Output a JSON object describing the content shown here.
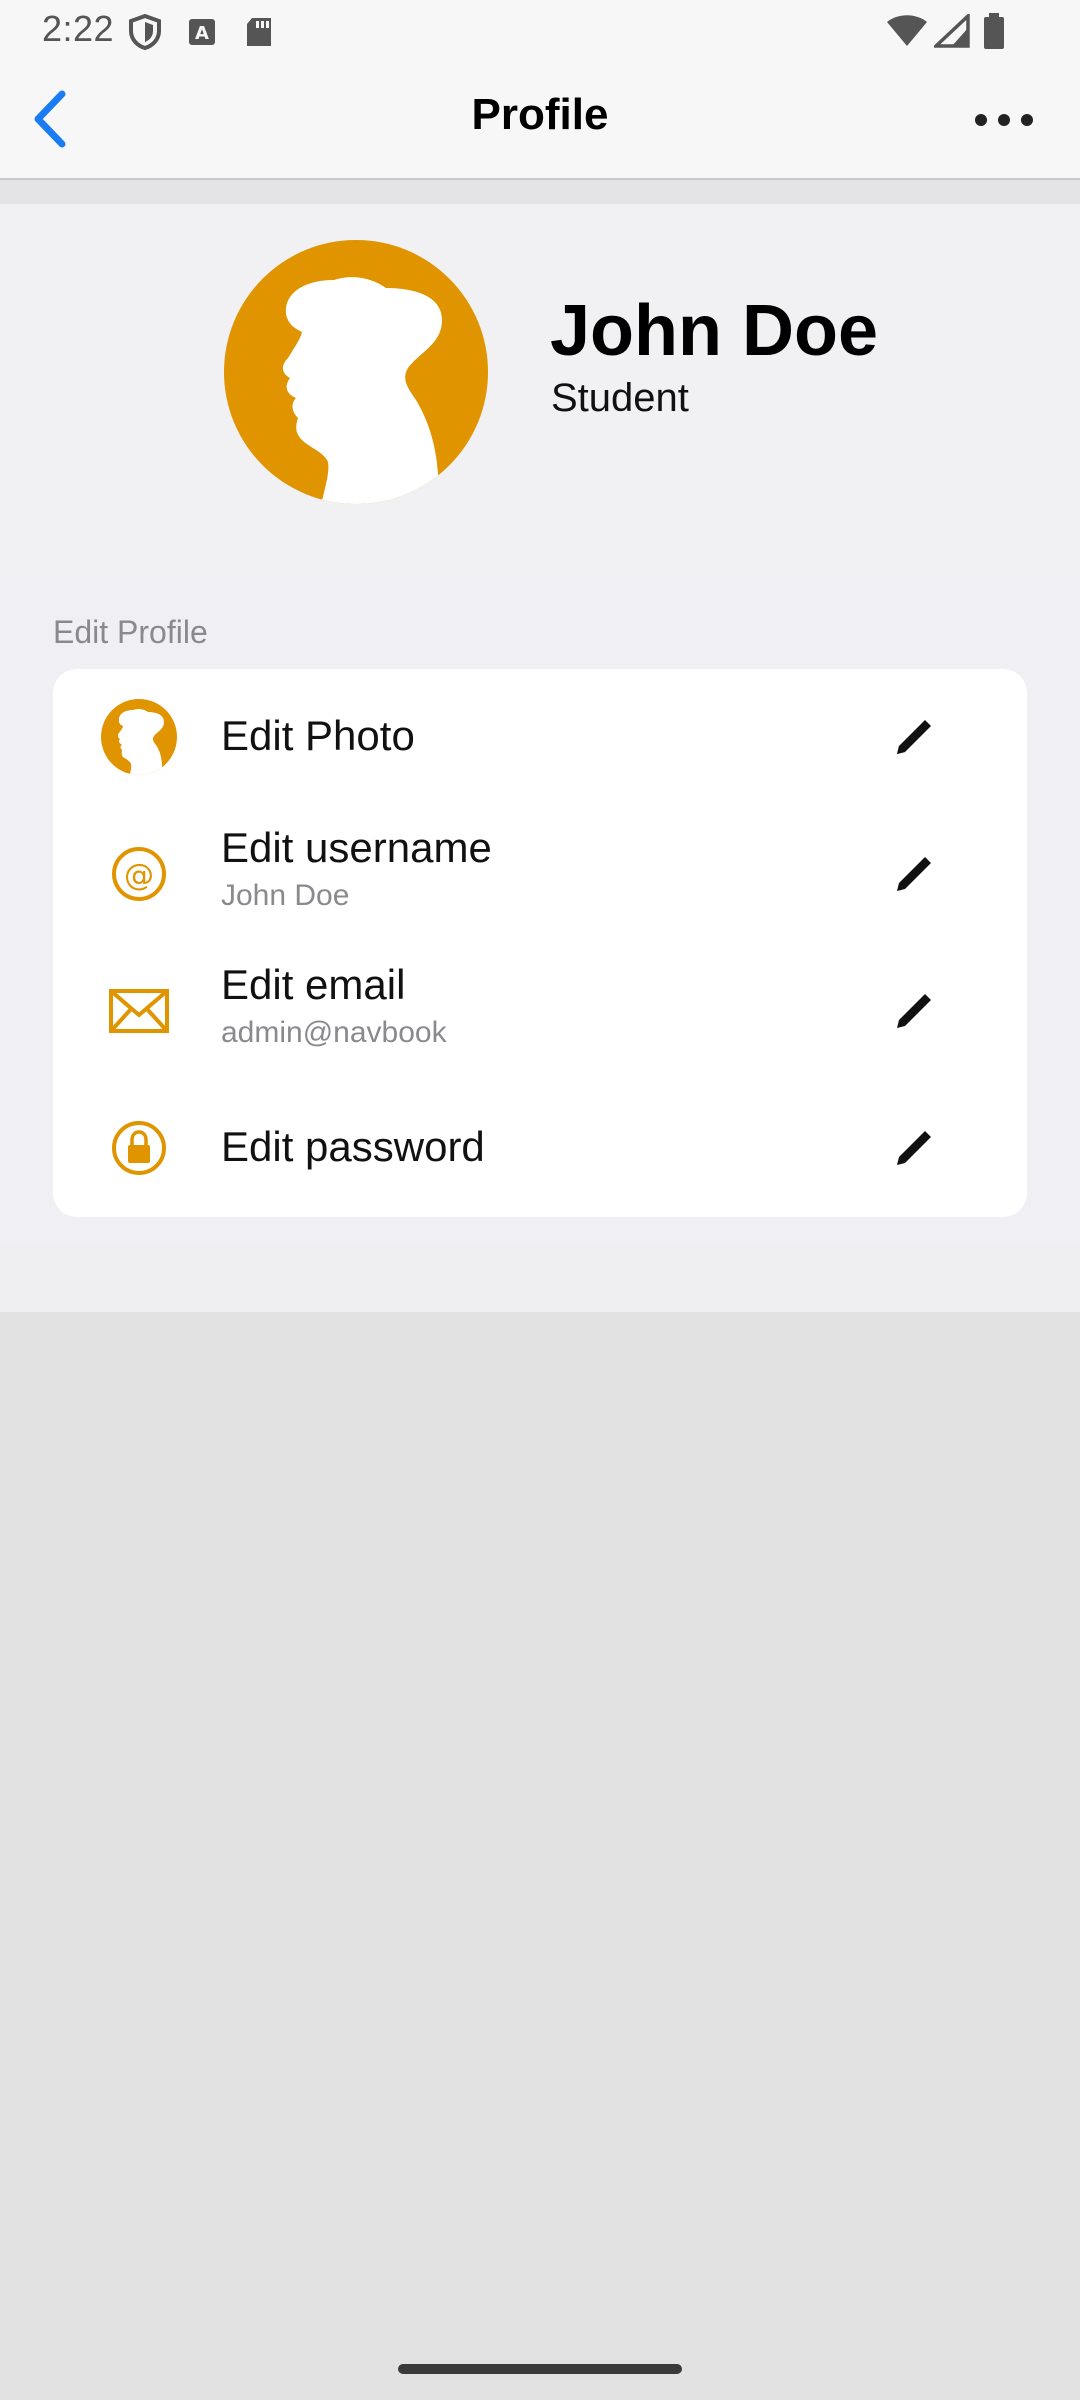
{
  "status_bar": {
    "time": "2:22"
  },
  "app_bar": {
    "title": "Profile"
  },
  "profile": {
    "name": "John Doe",
    "role": "Student"
  },
  "edit_section": {
    "label": "Edit Profile",
    "rows": [
      {
        "title": "Edit Photo",
        "subtitle": "",
        "icon": "photo-icon"
      },
      {
        "title": "Edit username",
        "subtitle": "John Doe",
        "icon": "at-sign-icon"
      },
      {
        "title": "Edit email",
        "subtitle": "admin@navbook",
        "icon": "envelope-icon"
      },
      {
        "title": "Edit password",
        "subtitle": "",
        "icon": "lock-icon"
      }
    ]
  },
  "colors": {
    "accent": "#e09400",
    "ios_blue": "#1a7cf2"
  }
}
